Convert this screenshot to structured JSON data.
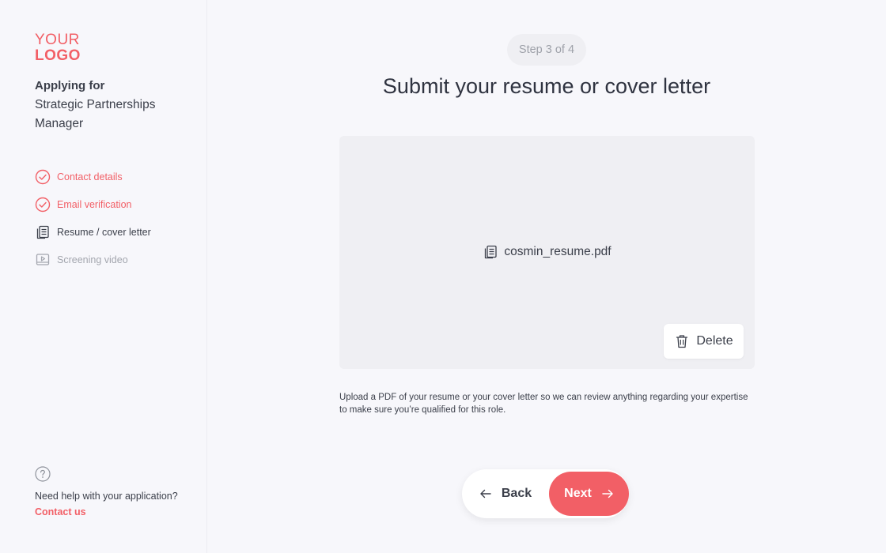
{
  "logo": {
    "top": "YOUR",
    "bottom": "LOGO"
  },
  "applying": {
    "label": "Applying for",
    "role": "Strategic Partnerships Manager"
  },
  "steps": [
    {
      "label": "Contact details",
      "status": "done",
      "icon": "check-circle-icon"
    },
    {
      "label": "Email verification",
      "status": "done",
      "icon": "check-circle-icon"
    },
    {
      "label": "Resume / cover letter",
      "status": "current",
      "icon": "document-icon"
    },
    {
      "label": "Screening video",
      "status": "todo",
      "icon": "video-icon"
    }
  ],
  "help": {
    "text": "Need help with your application?",
    "link": "Contact us"
  },
  "header": {
    "step_indicator": "Step 3 of 4",
    "title": "Submit your resume or cover letter"
  },
  "upload": {
    "file_name": "cosmin_resume.pdf",
    "delete_label": "Delete",
    "hint": "Upload a PDF of your resume or your cover letter so we can review anything regarding your expertise to make sure you’re qualified for this role."
  },
  "nav": {
    "back_label": "Back",
    "next_label": "Next"
  },
  "colors": {
    "accent": "#f25f66",
    "background": "#f7f7fb",
    "panel": "#efeff3",
    "text": "#3b3f4a",
    "muted": "#a3a6ae"
  }
}
